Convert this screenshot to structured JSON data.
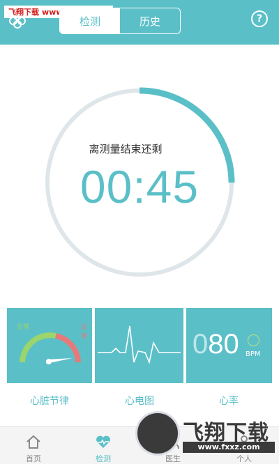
{
  "watermark": {
    "brand": "飞翔下载",
    "url": "www.FXXZ.com"
  },
  "header": {
    "tabs": [
      {
        "label": "检测",
        "active": true
      },
      {
        "label": "历史",
        "active": false
      }
    ],
    "help_glyph": "?",
    "icons": {
      "left": "flower-icon",
      "right": "help-icon"
    }
  },
  "measurement": {
    "label": "离测量结束还剩",
    "timer": "00:45",
    "progress": 0.25
  },
  "cards": {
    "rhythm": {
      "label": "心脏节律",
      "normal": "正常",
      "high": "过速",
      "icon": "gauge-icon"
    },
    "ecg": {
      "label": "心电图",
      "icon": "ecg-waveform-icon"
    },
    "heart_rate": {
      "label": "心率",
      "value_dim": "0",
      "value": "80",
      "unit": "BPM",
      "icon": "smile-icon"
    }
  },
  "tabbar": {
    "items": [
      {
        "label": "首页",
        "icon": "home-icon",
        "active": false
      },
      {
        "label": "检测",
        "icon": "heart-icon",
        "active": true
      },
      {
        "label": "医生",
        "icon": "doctor-icon",
        "active": false
      },
      {
        "label": "个人",
        "icon": "person-icon",
        "active": false
      }
    ]
  },
  "logo": {
    "main": "飞翔下载",
    "url": "www.fxxz.com"
  },
  "colors": {
    "accent": "#5bbfc8",
    "ring_track": "#dfe6ea",
    "gauge_green": "#9bd56b",
    "gauge_red": "#e57a7a"
  }
}
